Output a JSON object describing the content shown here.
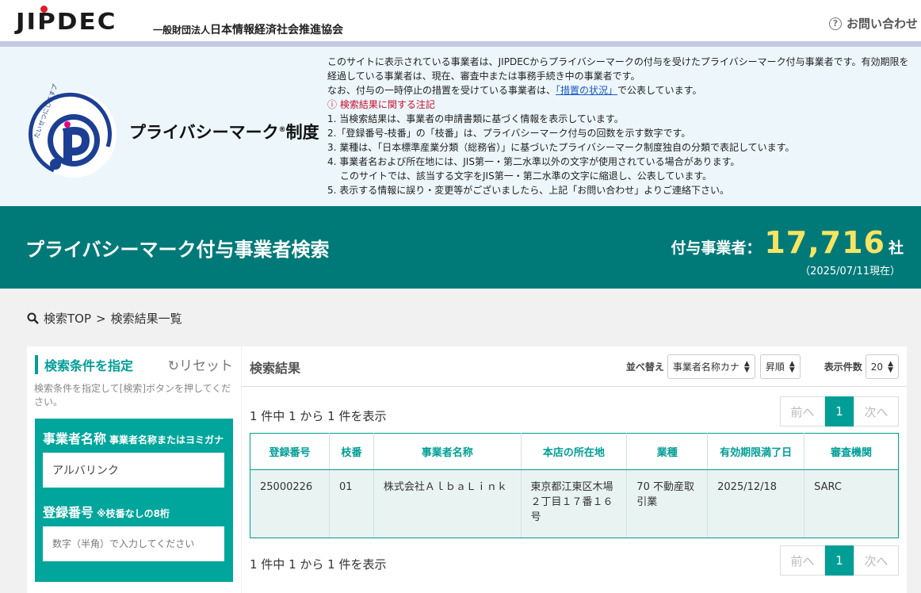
{
  "header": {
    "logo": "JIPDEC",
    "org_prefix": "一般財団法人",
    "org_name": "日本情報経済社会推進協会",
    "contact_label": "お問い合わせ"
  },
  "notice": {
    "pmark_title": "プライバシーマーク",
    "pmark_suffix": "制度",
    "pmark_reg": "®",
    "seal_text": "たいせつにしますプライバシー",
    "line1": "このサイトに表示されている事業者は、JIPDECからプライバシーマークの付与を受けたプライバシーマーク付与事業者です。有効期限を経過している事業者は、現在、審査中または事務手続き中の事業者です。",
    "line2_pre": "なお、付与の一時停止の措置を受けている事業者は、",
    "line2_link": "「措置の状況」",
    "line2_post": "で公表しています。",
    "caution": "検索結果に関する注記",
    "items": [
      "1. 当検索結果は、事業者の申請書類に基づく情報を表示しています。",
      "2.「登録番号-枝番」の「枝番」は、プライバシーマーク付与の回数を示す数字です。",
      "3. 業種は、「日本標準産業分類（総務省）」に基づいたプライバシーマーク制度独自の分類で表記しています。",
      "4. 事業者名および所在地には、JIS第一・第二水準以外の文字が使用されている場合があります。",
      "このサイトでは、該当する文字をJIS第一・第二水準の文字に縮退し、公表しています。",
      "5. 表示する情報に誤り・変更等がございましたら、上記「お問い合わせ」よりご連絡下さい。"
    ]
  },
  "band": {
    "title": "プライバシーマーク付与事業者検索",
    "count_label": "付与事業者：",
    "count": "17,716",
    "unit": "社",
    "as_of": "（2025/07/11現在）"
  },
  "breadcrumb": {
    "top": "検索TOP",
    "sep": ">",
    "current": "検索結果一覧"
  },
  "search": {
    "title": "検索条件を指定",
    "reset": "リセット",
    "hint": "検索条件を指定して[検索]ボタンを押してください。",
    "name_label": "事業者名称",
    "name_sub": "事業者名称またはヨミガナ",
    "name_value": "アルバリンク",
    "reg_label": "登録番号",
    "reg_sub": "※枝番なしの8桁",
    "reg_placeholder": "数字（半角）で入力してください"
  },
  "results": {
    "title": "検索結果",
    "sort_label": "並べ替え",
    "sort_value": "事業者名称カナ",
    "order_value": "昇順",
    "per_page_label": "表示件数",
    "per_page_value": "20",
    "count_text": "1 件中 1 から 1 件を表示",
    "prev": "前へ",
    "page": "1",
    "next": "次へ",
    "columns": [
      "登録番号",
      "枝番",
      "事業者名称",
      "本店の所在地",
      "業種",
      "有効期限満了日",
      "審査機関"
    ],
    "rows": [
      {
        "reg_no": "25000226",
        "branch": "01",
        "name": "株式会社ＡｌｂａＬｉｎｋ",
        "address": "東京都江東区木場２丁目１７番１６号",
        "industry": "70 不動産取引業",
        "expiry": "2025/12/18",
        "auditor": "SARC"
      }
    ]
  },
  "colors": {
    "teal": "#007a78",
    "accent": "#009e96",
    "count_yellow": "#f8e463",
    "logo_red": "#e01b2b"
  }
}
